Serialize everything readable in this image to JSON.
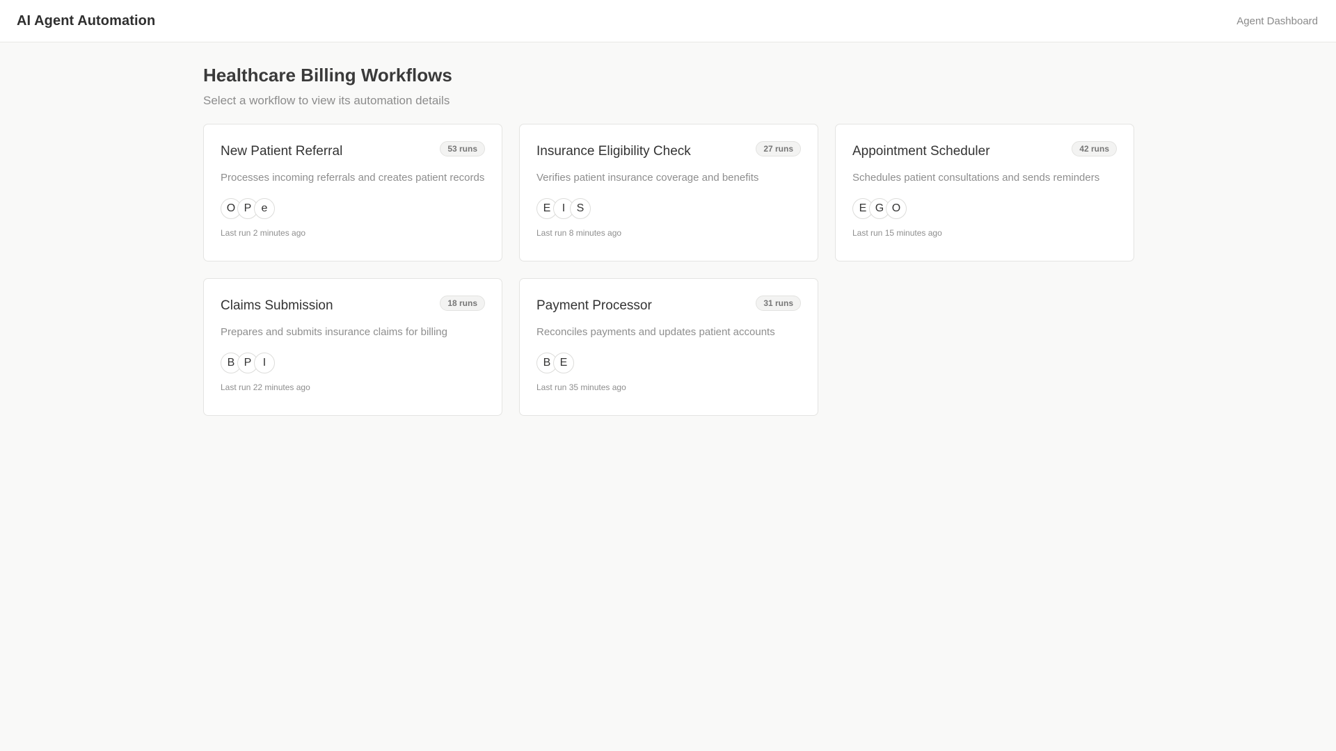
{
  "header": {
    "title": "AI Agent Automation",
    "nav_link": "Agent Dashboard"
  },
  "page": {
    "title": "Healthcare Billing Workflows",
    "subtitle": "Select a workflow to view its automation details"
  },
  "workflows": [
    {
      "title": "New Patient Referral",
      "runs": "53 runs",
      "description": "Processes incoming referrals and creates patient records",
      "avatars": [
        "O",
        "P",
        "e"
      ],
      "last_run": "Last run 2 minutes ago"
    },
    {
      "title": "Insurance Eligibility Check",
      "runs": "27 runs",
      "description": "Verifies patient insurance coverage and benefits",
      "avatars": [
        "E",
        "I",
        "S"
      ],
      "last_run": "Last run 8 minutes ago"
    },
    {
      "title": "Appointment Scheduler",
      "runs": "42 runs",
      "description": "Schedules patient consultations and sends reminders",
      "avatars": [
        "E",
        "G",
        "O"
      ],
      "last_run": "Last run 15 minutes ago"
    },
    {
      "title": "Claims Submission",
      "runs": "18 runs",
      "description": "Prepares and submits insurance claims for billing",
      "avatars": [
        "B",
        "P",
        "I"
      ],
      "last_run": "Last run 22 minutes ago"
    },
    {
      "title": "Payment Processor",
      "runs": "31 runs",
      "description": "Reconciles payments and updates patient accounts",
      "avatars": [
        "B",
        "E"
      ],
      "last_run": "Last run 35 minutes ago"
    }
  ]
}
